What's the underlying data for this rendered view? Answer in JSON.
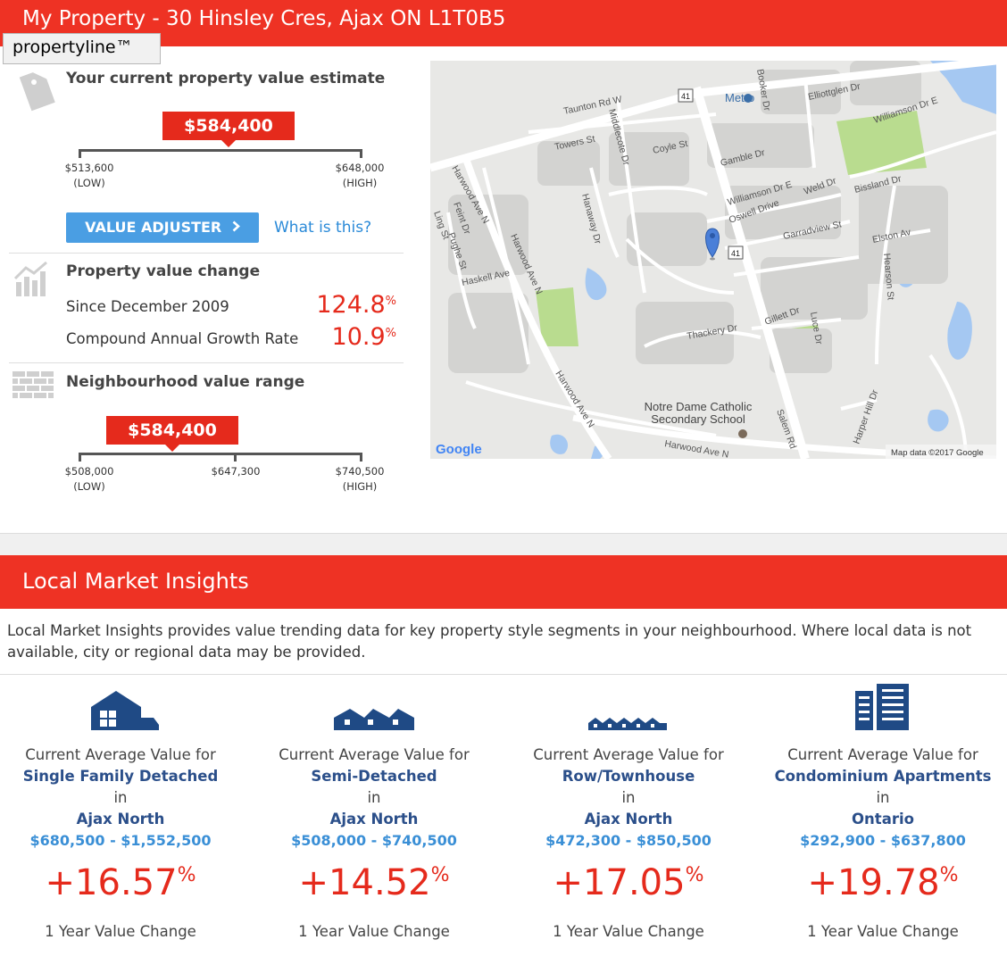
{
  "header": {
    "title": "My Property - 30 Hinsley Cres, Ajax ON L1T0B5",
    "tooltip": "propertyline™"
  },
  "estimate": {
    "heading": "Your current property value estimate",
    "value": "$584,400",
    "low_value": "$513,600",
    "low_label": "(LOW)",
    "high_value": "$648,000",
    "high_label": "(HIGH)",
    "adjuster_button": "VALUE ADJUSTER",
    "what_is_this": "What is this?"
  },
  "value_change": {
    "heading": "Property value change",
    "rows": [
      {
        "label": "Since December 2009",
        "value": "124.8",
        "unit": "%"
      },
      {
        "label": "Compound Annual Growth Rate",
        "value": "10.9",
        "unit": "%"
      }
    ]
  },
  "neighbourhood": {
    "heading": "Neighbourhood value range",
    "value": "$584,400",
    "low_value": "$508,000",
    "low_label": "(LOW)",
    "mid_value": "$647,300",
    "high_value": "$740,500",
    "high_label": "(HIGH)"
  },
  "map": {
    "labels": {
      "taunton": "Taunton Rd W",
      "metro": "Metro",
      "elliottglen": "Elliottglen Dr",
      "williamson_e": "Williamson Dr E",
      "towers": "Towers St",
      "coyle": "Coyle St",
      "gamble": "Gamble Dr",
      "williamson": "Williamson Dr E",
      "weld": "Weld Dr",
      "bissland": "Bissland Dr",
      "oswell": "Oswell Drive",
      "middlecote": "Middlecote Dr",
      "harwood": "Harwood Ave N",
      "garradview": "Garradview St",
      "elston": "Elston Av",
      "hearson": "Hearson St",
      "haskell": "Haskell Ave",
      "hanaway": "Hanaway Dr",
      "pughe": "Pughe St",
      "gillett": "Gillett Dr",
      "luce": "Luce Dr",
      "thackery": "Thackery Dr",
      "school": "Notre Dame Catholic Secondary School",
      "salem": "Salem Rd",
      "harwood_s": "Harwood Ave N",
      "harper": "Harper Hill Dr",
      "booker": "Booker Dr",
      "feint": "Feint Dr",
      "ling": "Ling St",
      "hwy41": "41",
      "google": "Google",
      "attribution": "Map data ©2017 Google"
    }
  },
  "insights": {
    "title": "Local Market Insights",
    "intro": "Local Market Insights provides value trending data for key property style segments in your neighbourhood. Where local data is not available, city or regional data may be provided.",
    "cards": [
      {
        "icon": "house-icon",
        "caption": "Current Average Value for",
        "type": "Single Family Detached",
        "in": "in",
        "area": "Ajax North",
        "range": "$680,500 - $1,552,500",
        "change": "+16.57",
        "unit": "%",
        "footer": "1 Year Value Change"
      },
      {
        "icon": "semi-detached-icon",
        "caption": "Current Average Value for",
        "type": "Semi-Detached",
        "in": "in",
        "area": "Ajax North",
        "range": "$508,000 - $740,500",
        "change": "+14.52",
        "unit": "%",
        "footer": "1 Year Value Change"
      },
      {
        "icon": "townhouse-icon",
        "caption": "Current Average Value for",
        "type": "Row/Townhouse",
        "in": "in",
        "area": "Ajax North",
        "range": "$472,300 - $850,500",
        "change": "+17.05",
        "unit": "%",
        "footer": "1 Year Value Change"
      },
      {
        "icon": "condo-icon",
        "caption": "Current Average Value for",
        "type": "Condominium Apartments",
        "in": "in",
        "area": "Ontario",
        "range": "$292,900 - $637,800",
        "change": "+19.78",
        "unit": "%",
        "footer": "1 Year Value Change"
      }
    ]
  },
  "colors": {
    "brand_red": "#ee3224",
    "button_blue": "#4a9ee3",
    "link_blue": "#2a8ad8",
    "navy": "#2b4f8a"
  }
}
